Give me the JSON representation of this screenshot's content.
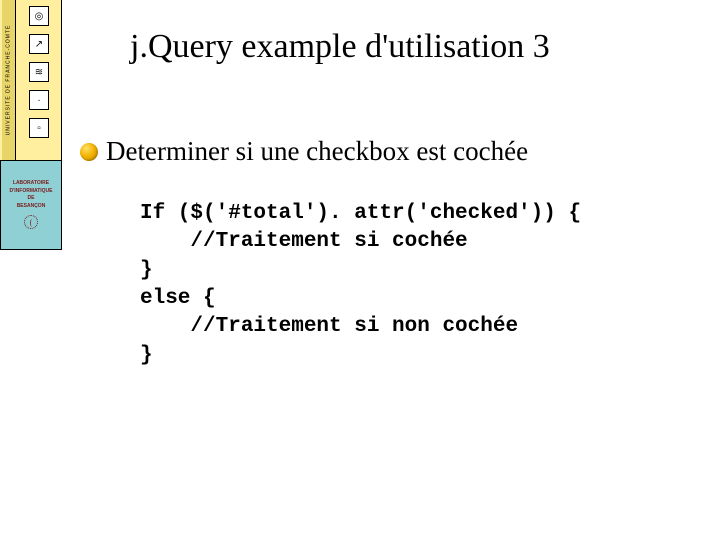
{
  "sidebar": {
    "vertical_text": "UNIVERSITE DE FRANCHE-COMTE",
    "icons": [
      {
        "name": "target-icon",
        "glyph": "◎"
      },
      {
        "name": "arrow-icon",
        "glyph": "↗"
      },
      {
        "name": "wave-icon",
        "glyph": "≋"
      },
      {
        "name": "dot-icon",
        "glyph": "·"
      },
      {
        "name": "box-icon",
        "glyph": "▫"
      }
    ],
    "lab_lines": [
      "LABORATOIRE",
      "D'INFORMATIQUE",
      "DE",
      "BESANÇON"
    ],
    "lab_symbol": "("
  },
  "slide": {
    "title": "j.Query example d'utilisation 3",
    "bullet": "Determiner si une checkbox est cochée",
    "code": "If ($('#total'). attr('checked')) {\n    //Traitement si cochée\n}\nelse {\n    //Traitement si non cochée\n}"
  }
}
